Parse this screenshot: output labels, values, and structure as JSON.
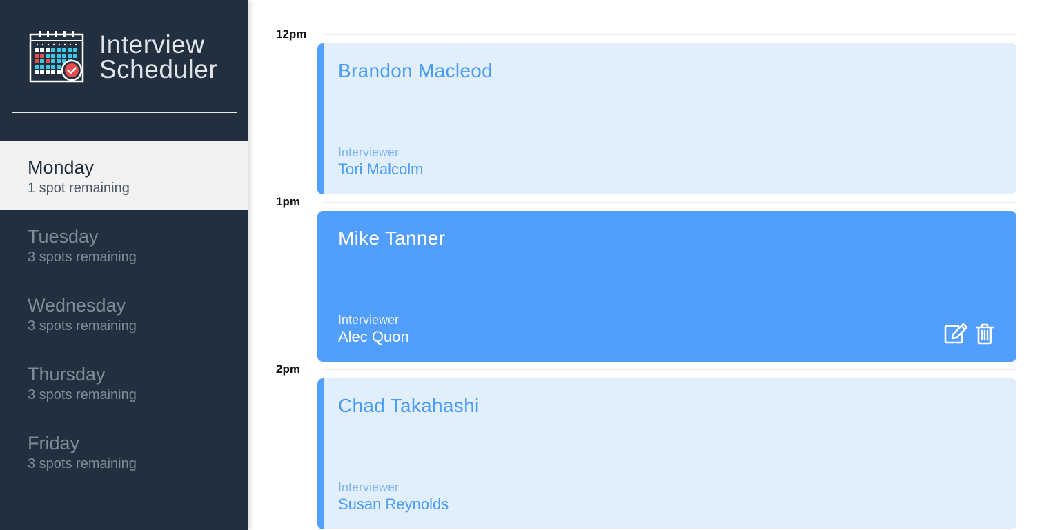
{
  "app": {
    "title_line1": "Interview",
    "title_line2": "Scheduler",
    "logo_icon": "calendar-check-icon"
  },
  "sidebar": {
    "days": [
      {
        "name": "Monday",
        "spots": "1 spot remaining",
        "selected": true
      },
      {
        "name": "Tuesday",
        "spots": "3 spots remaining",
        "selected": false
      },
      {
        "name": "Wednesday",
        "spots": "3 spots remaining",
        "selected": false
      },
      {
        "name": "Thursday",
        "spots": "3 spots remaining",
        "selected": false
      },
      {
        "name": "Friday",
        "spots": "3 spots remaining",
        "selected": false
      }
    ]
  },
  "schedule": {
    "appointments": [
      {
        "time": "12pm",
        "student": "Brandon Macleod",
        "interviewer_label": "Interviewer",
        "interviewer": "Tori Malcolm"
      },
      {
        "time": "1pm",
        "student": "Mike Tanner",
        "interviewer_label": "Interviewer",
        "interviewer": "Alec Quon",
        "hovered": true,
        "actions": [
          "edit-icon",
          "trash-icon"
        ]
      },
      {
        "time": "2pm",
        "student": "Chad Takahashi",
        "interviewer_label": "Interviewer",
        "interviewer": "Susan Reynolds"
      }
    ]
  },
  "colors": {
    "sidebar_bg": "#222f3e",
    "selected_day_bg": "#f2f2f2",
    "card_bg": "#e1eefc",
    "card_accent": "#539ffc",
    "card_active_bg": "#529efc"
  }
}
